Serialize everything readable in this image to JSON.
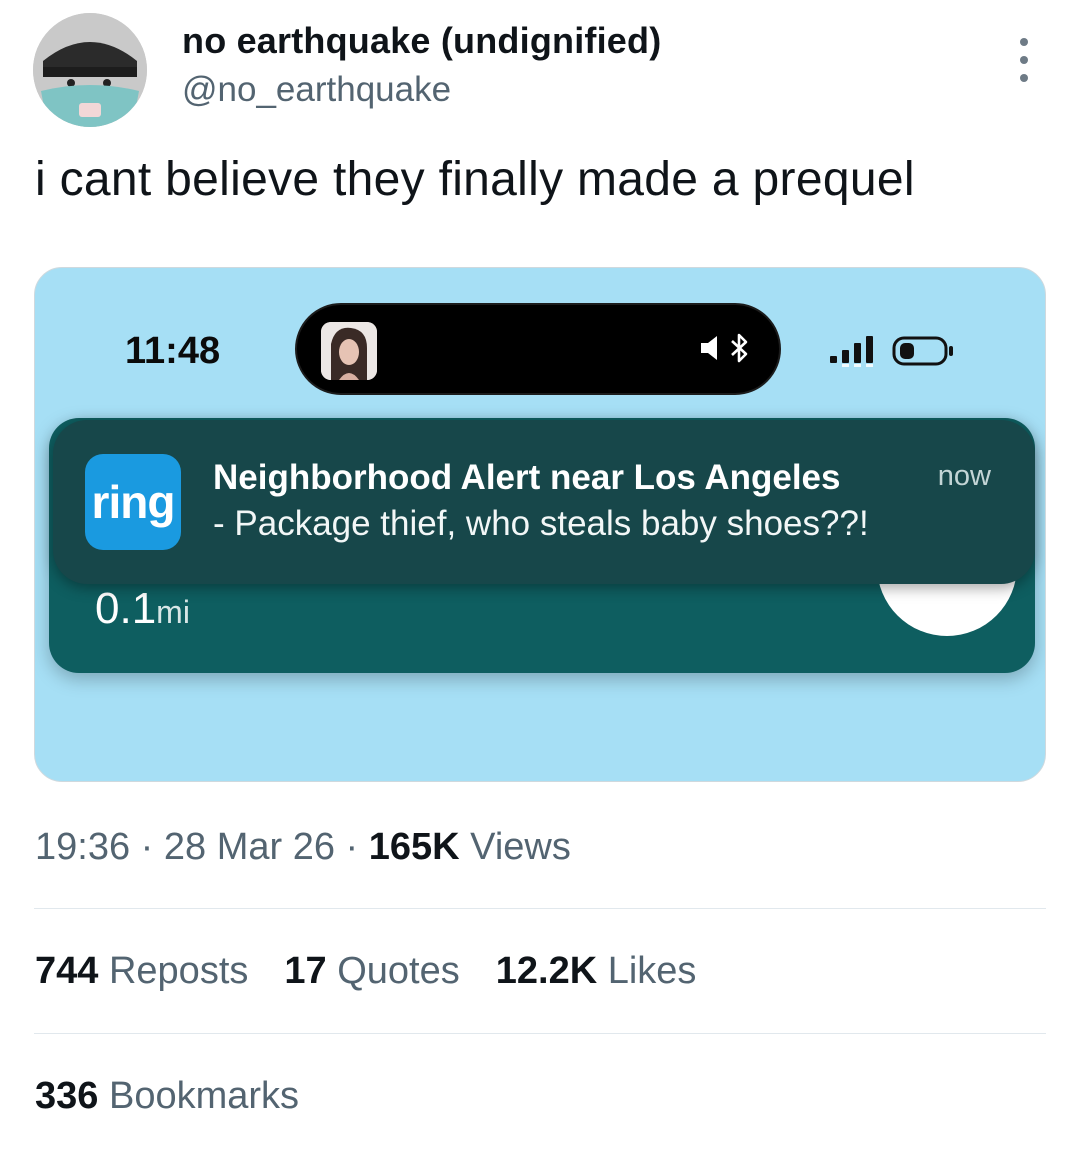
{
  "author": {
    "display_name": "no earthquake (undignified)",
    "handle": "@no_earthquake"
  },
  "tweet": {
    "text": "i cant believe they finally made a prequel"
  },
  "media": {
    "status_bar": {
      "time": "11:48"
    },
    "notification": {
      "app_icon_label": "ring",
      "title": "Neighborhood Alert near Los Angeles",
      "body": "- Package thief, who steals baby shoes??!",
      "time": "now"
    },
    "alert_card": {
      "distance": "0.1",
      "unit": "mi"
    }
  },
  "meta": {
    "time": "19:36",
    "date": "28 Mar 26",
    "views_count": "165K",
    "views_label": "Views"
  },
  "stats": {
    "reposts_count": "744",
    "reposts_label": "Reposts",
    "quotes_count": "17",
    "quotes_label": "Quotes",
    "likes_count": "12.2K",
    "likes_label": "Likes",
    "bookmarks_count": "336",
    "bookmarks_label": "Bookmarks"
  },
  "colors": {
    "media_background": "#a6dff5",
    "alert_card": "#0e5e60",
    "notification_background": "#17474a",
    "ring_brand": "#1a9ae0"
  },
  "icons": [
    "avatar",
    "more-options-icon",
    "ring-app-icon",
    "speaker-mute-icon",
    "bluetooth-icon",
    "signal-icon",
    "battery-icon"
  ]
}
